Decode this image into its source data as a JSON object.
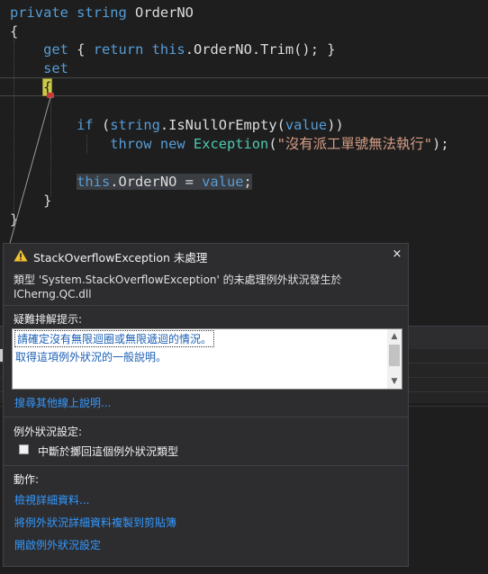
{
  "editor": {
    "line1": {
      "kw1": "private",
      "kw2": "string",
      "name": "OrderNO"
    },
    "line2": {
      "brace": "{"
    },
    "line3": {
      "kw_get": "get",
      "open": "{",
      "kw_return": "return",
      "kw_this": "this",
      "rest": ".OrderNO.Trim();",
      "close": "}"
    },
    "line4": {
      "kw_set": "set"
    },
    "line5": {
      "brace": "{"
    },
    "line7": {
      "kw_if": "if",
      "open_paren": "(",
      "ty": "string",
      "method": ".IsNullOrEmpty(",
      "kw_value": "value",
      "close": "))"
    },
    "line8": {
      "kw_throw": "throw",
      "kw_new": "new",
      "ty": "Exception",
      "open": "(",
      "str": "\"沒有派工單號無法執行\"",
      "close": ");"
    },
    "line10": {
      "kw_this": "this",
      "mid": ".OrderNO = ",
      "kw_value": "value",
      "semi": ";"
    },
    "line11": {
      "brace": "}"
    },
    "line12": {
      "brace": "}"
    }
  },
  "popup": {
    "title": "StackOverflowException 未處理",
    "close_glyph": "×",
    "description_line1": "類型 'System.StackOverflowException' 的未處理例外狀況發生於",
    "description_line2": "ICherng.QC.dll",
    "tips_header": "疑難排解提示:",
    "tips": [
      "請確定沒有無限迴圈或無限遞迴的情況。",
      "取得這項例外狀況的一般說明。"
    ],
    "search_link": "搜尋其他線上說明...",
    "settings_header": "例外狀況設定:",
    "break_checkbox_label": "中斷於擲回這個例外狀況類型",
    "break_checkbox_checked": false,
    "actions_header": "動作:",
    "actions": [
      "檢視詳細資料...",
      "將例外狀況詳細資料複製到剪貼簿",
      "開啟例外狀況設定"
    ]
  },
  "icons": {
    "warning": "warning-triangle-icon",
    "close": "close-icon",
    "scroll_up": "chevron-up-icon",
    "scroll_down": "chevron-down-icon"
  },
  "colors": {
    "editor_bg": "#1e1e1e",
    "keyword": "#569cd6",
    "type": "#4ec9b0",
    "string": "#d69d85",
    "popup_bg": "#2d2d30",
    "link": "#3399ff",
    "warning": "#f2c230"
  }
}
